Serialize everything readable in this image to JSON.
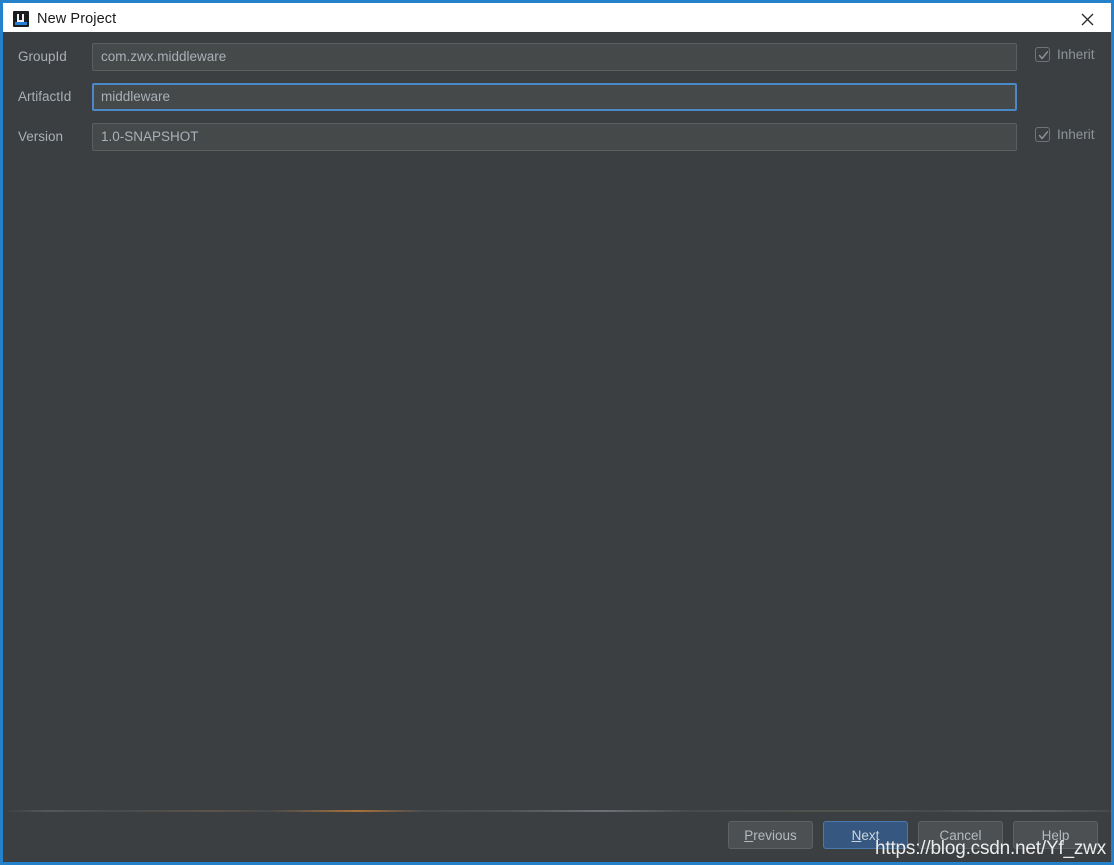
{
  "titlebar": {
    "title": "New Project",
    "icon": "intellij-idea-icon",
    "close_icon": "close-icon"
  },
  "form": {
    "rows": [
      {
        "label": "GroupId",
        "value": "com.zwx.middleware",
        "focused": false,
        "inherit": {
          "label": "Inherit",
          "checked": true
        }
      },
      {
        "label": "ArtifactId",
        "value": "middleware",
        "focused": true,
        "inherit": null
      },
      {
        "label": "Version",
        "value": "1.0-SNAPSHOT",
        "focused": false,
        "inherit": {
          "label": "Inherit",
          "checked": true
        }
      }
    ]
  },
  "footer": {
    "buttons": [
      {
        "label": "Previous",
        "mnemonic": "P",
        "rest": "revious",
        "default": false
      },
      {
        "label": "Next",
        "mnemonic": "N",
        "rest": "ext",
        "default": true
      },
      {
        "label": "Cancel",
        "mnemonic": "",
        "rest": "Cancel",
        "default": false
      },
      {
        "label": "Help",
        "mnemonic": "",
        "rest": "Help",
        "default": false
      }
    ]
  },
  "watermark": {
    "text": "https://blog.csdn.net/Yf_zwx"
  },
  "colors": {
    "window_border": "#2681CB",
    "panel_bg": "#3C3F41",
    "field_bg": "#45494A",
    "focus_border": "#4A88C7",
    "default_button_bg": "#365880",
    "label_text": "#A8AFB6"
  }
}
